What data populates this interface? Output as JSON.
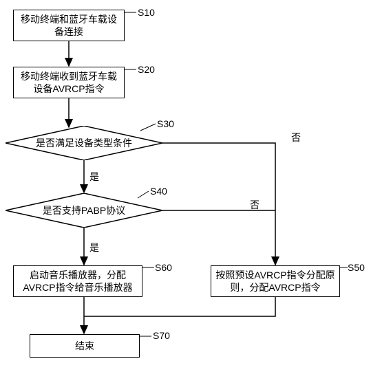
{
  "steps": {
    "s10": {
      "id": "S10",
      "text": "移动终端和蓝牙车载设备连接"
    },
    "s20": {
      "id": "S20",
      "text": "移动终端收到蓝牙车载设备AVRCP指令"
    },
    "s30": {
      "id": "S30",
      "text": "是否满足设备类型条件"
    },
    "s40": {
      "id": "S40",
      "text": "是否支持PABP协议"
    },
    "s50": {
      "id": "S50",
      "text": "按照预设AVRCP指令分配原则，分配AVRCP指令"
    },
    "s60": {
      "id": "S60",
      "text": "启动音乐播放器，分配AVRCP指令给音乐播放器"
    },
    "s70": {
      "id": "S70",
      "text": "结束"
    }
  },
  "labels": {
    "yes": "是",
    "no": "否"
  }
}
